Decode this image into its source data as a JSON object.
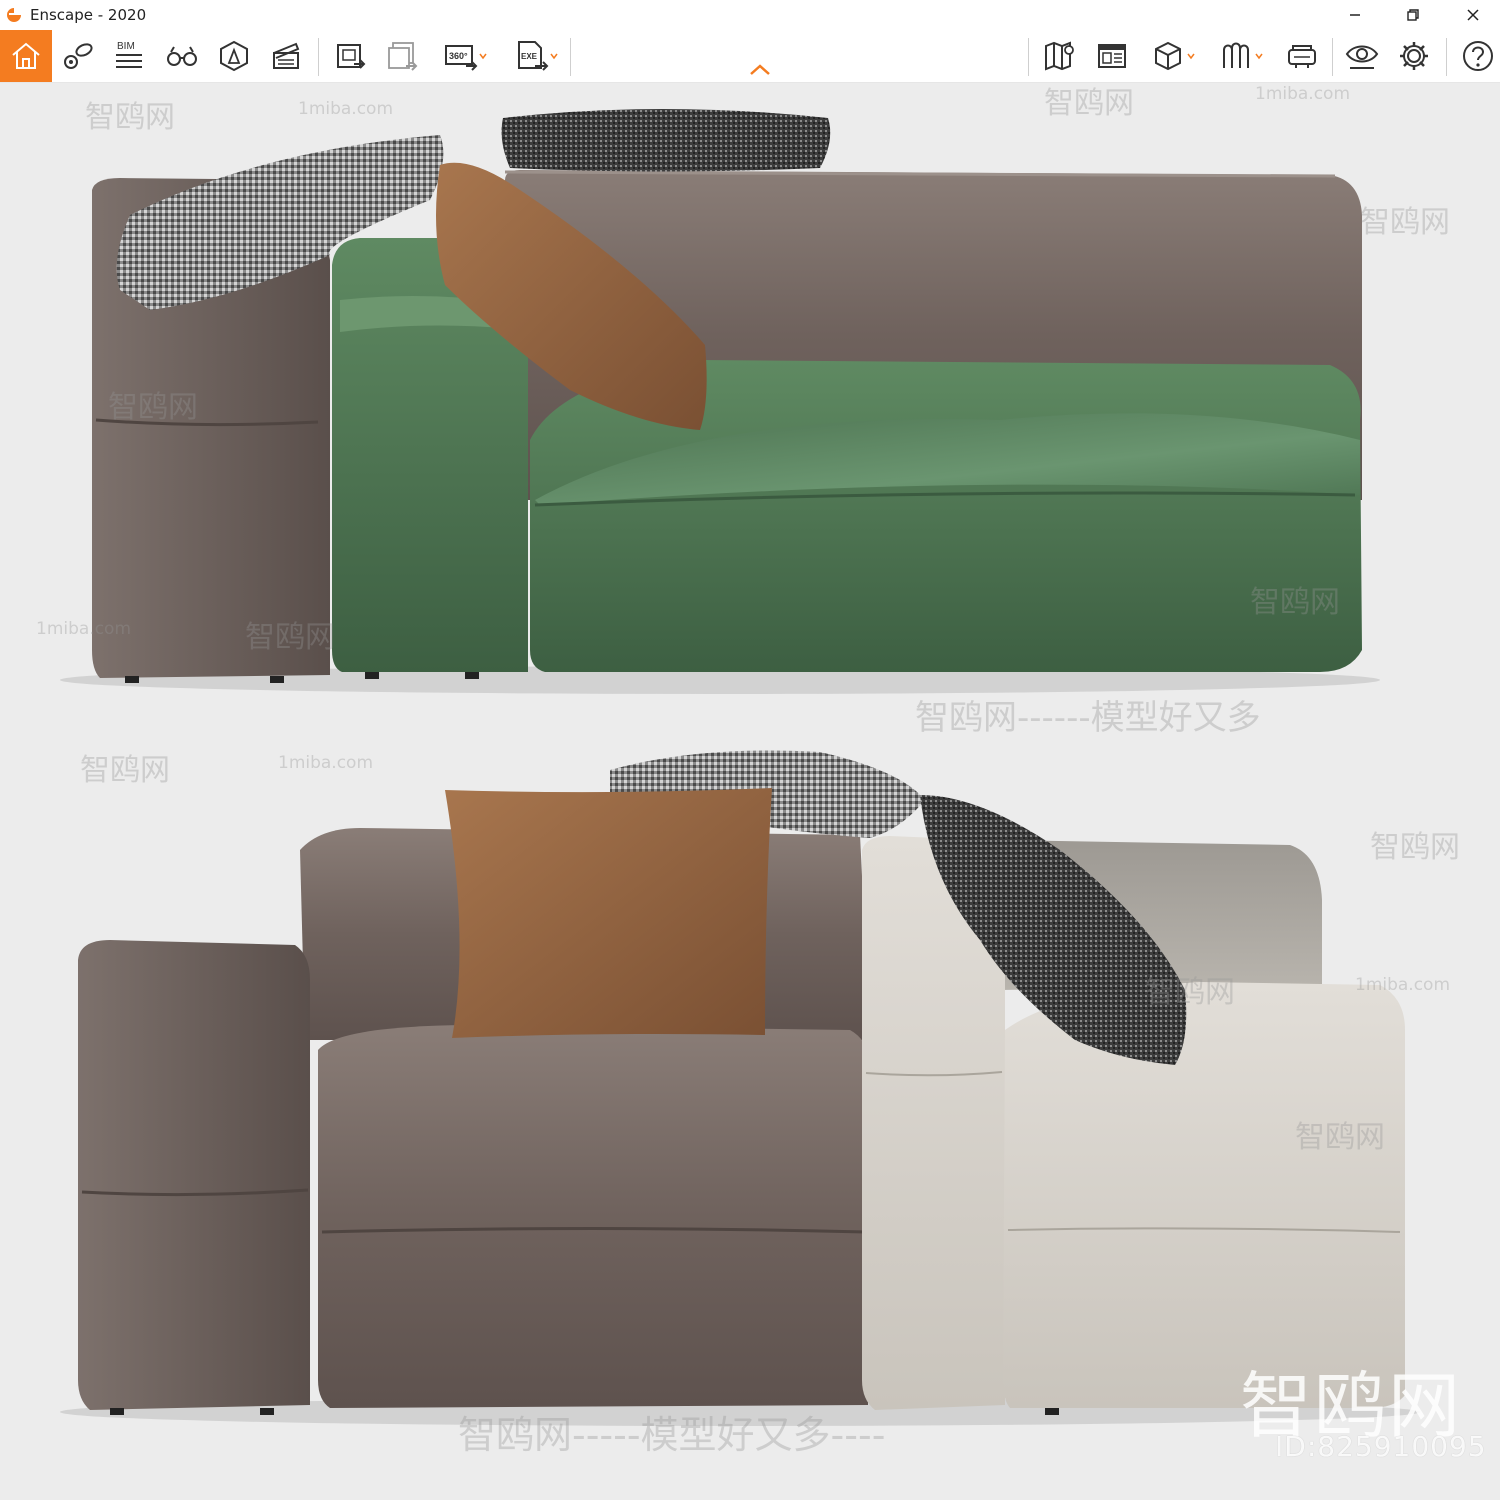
{
  "window": {
    "title": "Enscape - 2020",
    "controls": [
      "minimize-icon",
      "restore-icon",
      "close-icon"
    ]
  },
  "toolbar": {
    "left_tools": [
      {
        "name": "home",
        "icon": "home-icon"
      },
      {
        "name": "views",
        "icon": "views-icon"
      },
      {
        "name": "bim",
        "icon": "bim-icon",
        "label": "BIM"
      },
      {
        "name": "binoculars",
        "icon": "binoculars-icon"
      },
      {
        "name": "asset-library",
        "icon": "asset-library-icon"
      },
      {
        "name": "video-editor",
        "icon": "clapperboard-icon"
      },
      {
        "name": "screenshot",
        "icon": "screenshot-icon"
      },
      {
        "name": "batch-render",
        "icon": "batch-render-icon"
      },
      {
        "name": "panorama",
        "icon": "panorama-icon",
        "label": "360°"
      },
      {
        "name": "export-exe",
        "icon": "export-exe-icon",
        "label": "EXE"
      }
    ],
    "right_tools": [
      {
        "name": "map",
        "icon": "map-icon"
      },
      {
        "name": "info",
        "icon": "info-panel-icon"
      },
      {
        "name": "cube",
        "icon": "cube-icon"
      },
      {
        "name": "material",
        "icon": "material-icon"
      },
      {
        "name": "vr",
        "icon": "vr-headset-icon"
      },
      {
        "name": "visual-settings",
        "icon": "eye-icon"
      },
      {
        "name": "settings",
        "icon": "gear-icon"
      },
      {
        "name": "help",
        "icon": "help-icon"
      }
    ],
    "accent": "#f47c20"
  },
  "watermarks": {
    "site": "1miba.com",
    "brand": "智鸥网",
    "slogan": "智鸥网------模型好又多",
    "slogan2": "智鸥网-----模型好又多----",
    "big": "智鸥网",
    "id": "ID:825910095"
  },
  "scene": {
    "colors": {
      "leather": "#7e716b",
      "velvet_green": "#4e7352",
      "linen_white": "#d6d2cb",
      "cushion_brown": "#8a5e3e",
      "cushion_tweed": "#6f6f6f"
    }
  }
}
